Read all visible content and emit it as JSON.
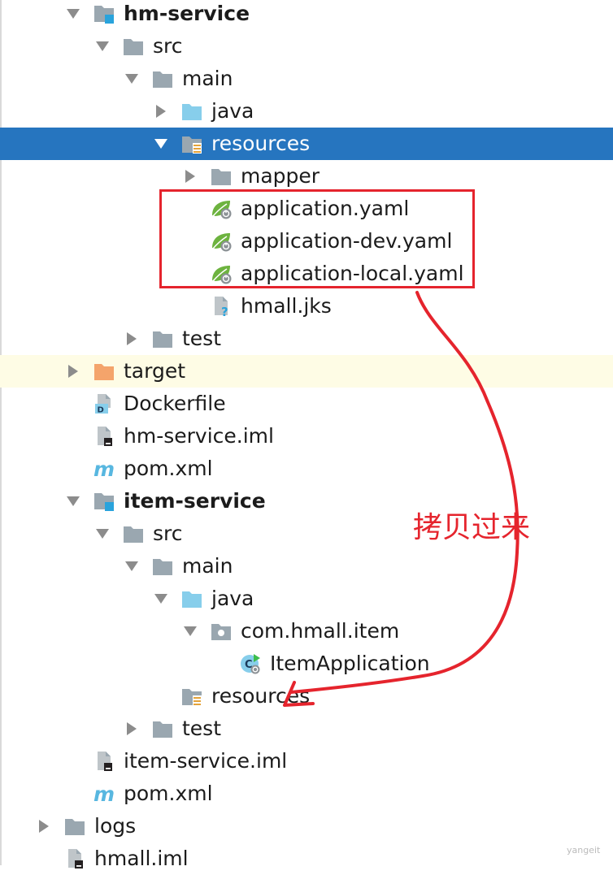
{
  "tree": [
    {
      "label": "hm-service",
      "icon": "module-folder-icon",
      "arrow": "down",
      "bold": true
    },
    {
      "label": "src",
      "icon": "folder-icon",
      "arrow": "down"
    },
    {
      "label": "main",
      "icon": "folder-icon",
      "arrow": "down"
    },
    {
      "label": "java",
      "icon": "source-folder-icon",
      "arrow": "right"
    },
    {
      "label": "resources",
      "icon": "resources-folder-icon",
      "arrow": "down",
      "selected": true
    },
    {
      "label": "mapper",
      "icon": "folder-icon",
      "arrow": "right"
    },
    {
      "label": "application.yaml",
      "icon": "spring-config-icon"
    },
    {
      "label": "application-dev.yaml",
      "icon": "spring-config-icon"
    },
    {
      "label": "application-local.yaml",
      "icon": "spring-config-icon"
    },
    {
      "label": "hmall.jks",
      "icon": "unknown-file-icon"
    },
    {
      "label": "test",
      "icon": "folder-icon",
      "arrow": "right"
    },
    {
      "label": "target",
      "icon": "excluded-folder-icon",
      "arrow": "right",
      "highlight": true
    },
    {
      "label": "Dockerfile",
      "icon": "dockerfile-icon"
    },
    {
      "label": "hm-service.iml",
      "icon": "iml-file-icon"
    },
    {
      "label": "pom.xml",
      "icon": "maven-icon"
    },
    {
      "label": "item-service",
      "icon": "module-folder-icon",
      "arrow": "down",
      "bold": true
    },
    {
      "label": "src",
      "icon": "folder-icon",
      "arrow": "down"
    },
    {
      "label": "main",
      "icon": "folder-icon",
      "arrow": "down"
    },
    {
      "label": "java",
      "icon": "source-folder-icon",
      "arrow": "down"
    },
    {
      "label": "com.hmall.item",
      "icon": "package-icon",
      "arrow": "down"
    },
    {
      "label": "ItemApplication",
      "icon": "spring-boot-class-icon"
    },
    {
      "label": "resources",
      "icon": "resources-folder-icon"
    },
    {
      "label": "test",
      "icon": "folder-icon",
      "arrow": "right"
    },
    {
      "label": "item-service.iml",
      "icon": "iml-file-icon"
    },
    {
      "label": "pom.xml",
      "icon": "maven-icon"
    },
    {
      "label": "logs",
      "icon": "folder-icon",
      "arrow": "right"
    },
    {
      "label": "hmall.iml",
      "icon": "iml-file-icon"
    }
  ],
  "annotation": {
    "text": "拷贝过来"
  },
  "watermark": "yangeit",
  "colors": {
    "selection": "#2675BF",
    "highlight_row": "#FEFCE5",
    "annotation_red": "#E5242D",
    "folder_gray": "#9AA7B0",
    "source_blue": "#87CEEB",
    "excluded_orange": "#F4A46B"
  }
}
